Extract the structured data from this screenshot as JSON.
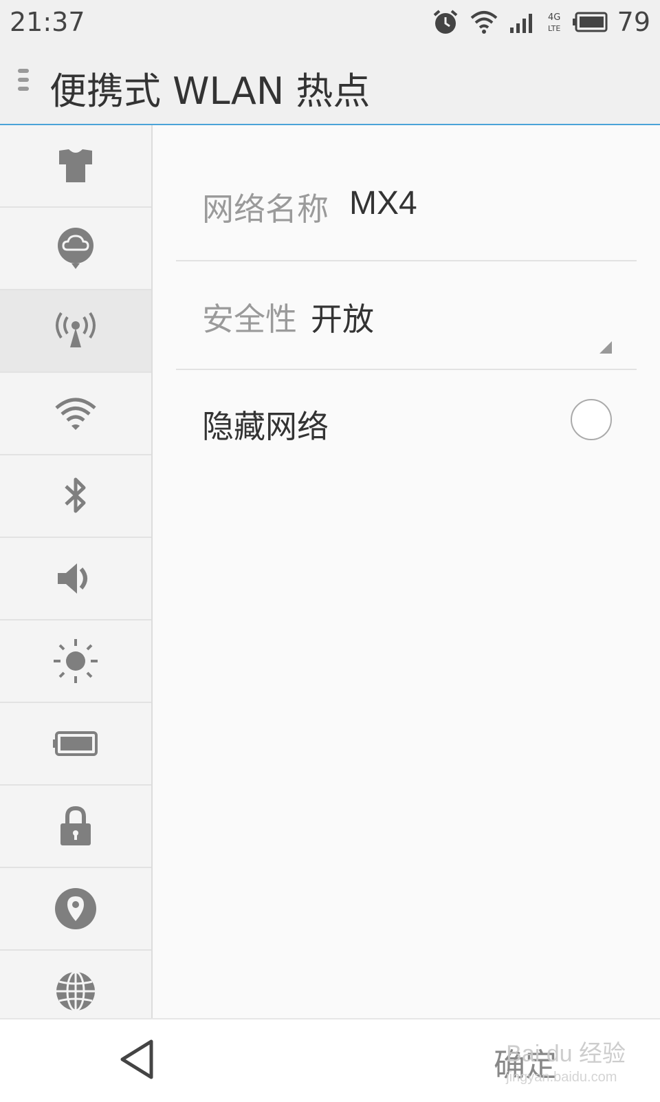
{
  "status_bar": {
    "time": "21:37",
    "battery_percent": "79",
    "icons": [
      "alarm-icon",
      "wifi-icon",
      "signal-icon",
      "4g-lte-icon",
      "battery-icon"
    ]
  },
  "header": {
    "title": "便携式 WLAN 热点",
    "menu_icon": "menu-handle-icon"
  },
  "sidebar": {
    "items": [
      {
        "icon": "shirt-icon",
        "active": false
      },
      {
        "icon": "cloud-icon",
        "active": false
      },
      {
        "icon": "hotspot-icon",
        "active": true
      },
      {
        "icon": "wifi-icon",
        "active": false
      },
      {
        "icon": "bluetooth-icon",
        "active": false
      },
      {
        "icon": "volume-icon",
        "active": false
      },
      {
        "icon": "brightness-icon",
        "active": false
      },
      {
        "icon": "battery-icon",
        "active": false
      },
      {
        "icon": "lock-icon",
        "active": false
      },
      {
        "icon": "location-icon",
        "active": false
      },
      {
        "icon": "globe-icon",
        "active": false
      }
    ]
  },
  "form": {
    "network_name_label": "网络名称",
    "network_name_value": "MX4",
    "security_label": "安全性",
    "security_value": "开放",
    "hide_network_label": "隐藏网络",
    "hide_network_checked": false
  },
  "bottom_bar": {
    "confirm_label": "确定",
    "back_icon": "back-triangle-icon"
  },
  "watermark": {
    "brand": "Bai du 经验",
    "url": "jingyan.baidu.com"
  },
  "colors": {
    "accent": "#4aa3d8",
    "icon_gray": "#8a8a8a",
    "background": "#fafafa"
  }
}
